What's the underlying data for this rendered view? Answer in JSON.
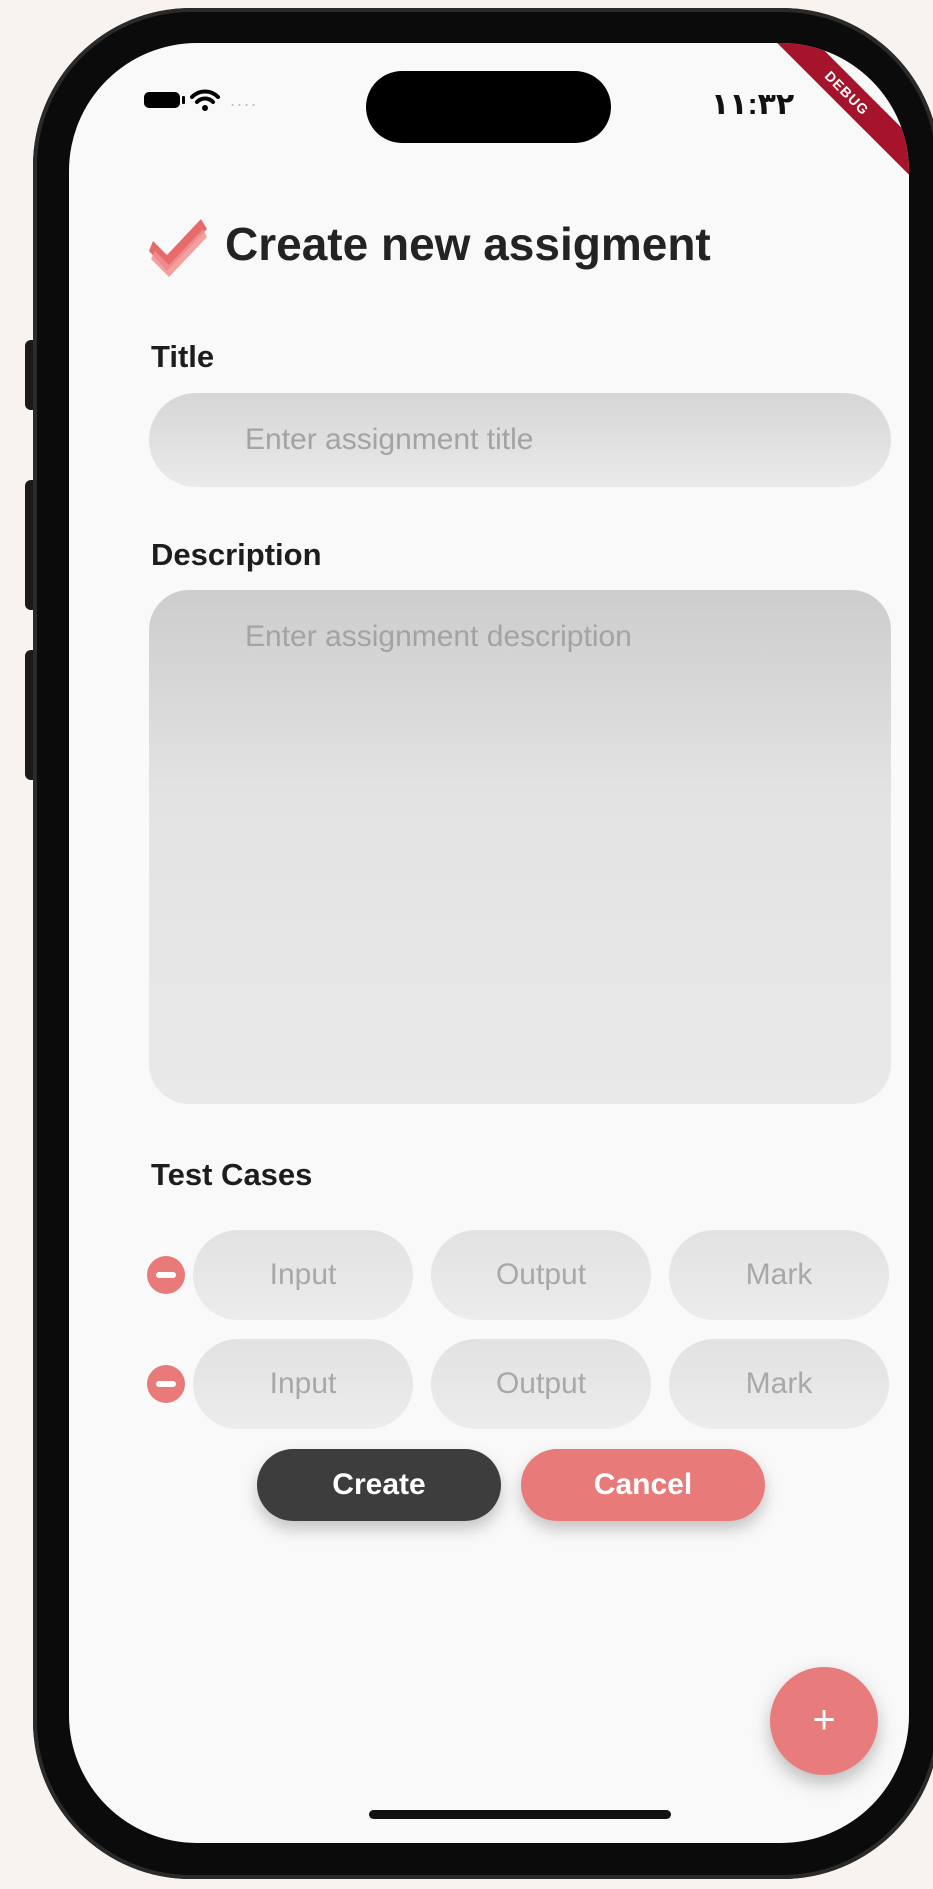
{
  "status_bar": {
    "time": "١١:٣٢",
    "dots": "....",
    "debug_banner": "DEBUG"
  },
  "header": {
    "title": "Create new assigment",
    "logo_icon": "double-check-icon"
  },
  "form": {
    "title_label": "Title",
    "title_placeholder": "Enter assignment title",
    "description_label": "Description",
    "description_placeholder": "Enter assignment description",
    "test_cases_label": "Test Cases",
    "test_cases": [
      {
        "input_placeholder": "Input",
        "output_placeholder": "Output",
        "mark_placeholder": "Mark"
      },
      {
        "input_placeholder": "Input",
        "output_placeholder": "Output",
        "mark_placeholder": "Mark"
      }
    ]
  },
  "actions": {
    "create_label": "Create",
    "cancel_label": "Cancel",
    "fab_label": "+"
  },
  "colors": {
    "accent": "#e87a7a",
    "dark_button": "#3d3d3d",
    "background": "#f9f9f9"
  }
}
